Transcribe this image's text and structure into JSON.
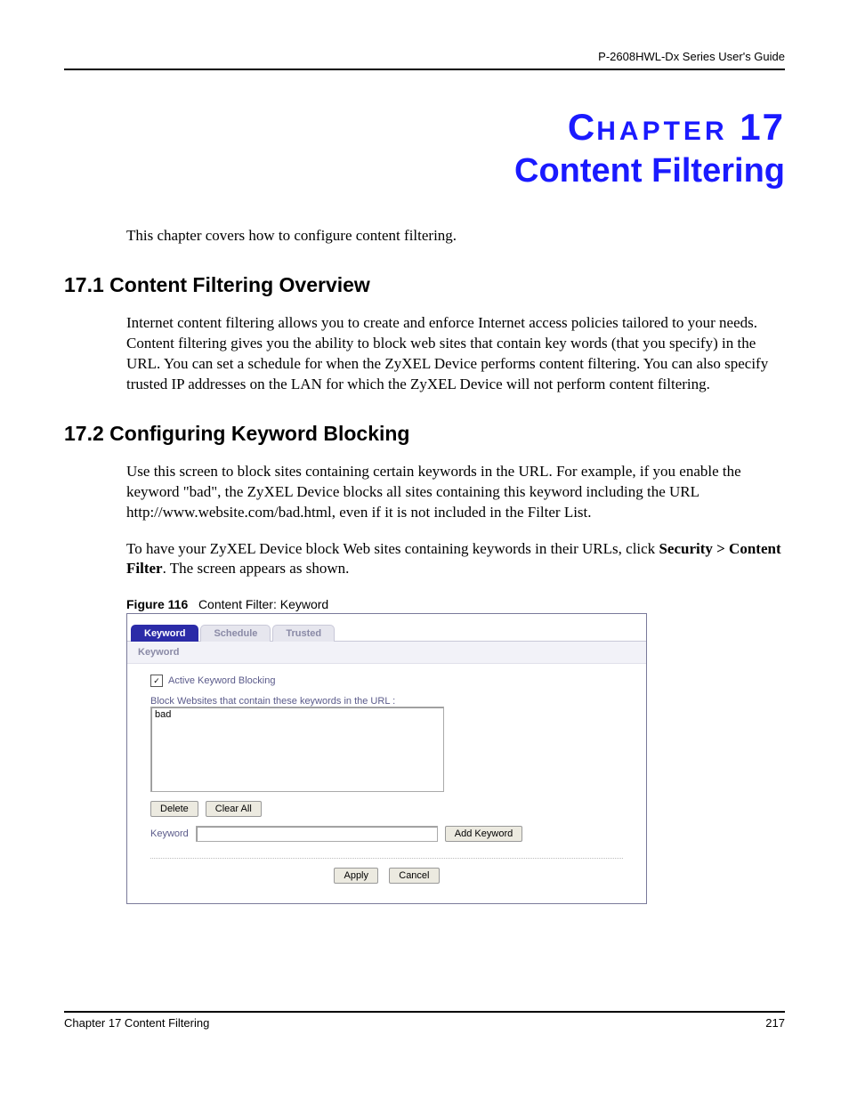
{
  "header": {
    "doc_title": "P-2608HWL-Dx Series User's Guide"
  },
  "chapter": {
    "label_small": "HAPTER",
    "label_prefix": "C",
    "number": "17",
    "title": "Content Filtering",
    "intro": "This chapter covers how to configure content filtering."
  },
  "section1": {
    "heading": "17.1  Content Filtering Overview",
    "body": "Internet content filtering allows you to create and enforce Internet access policies tailored to your needs. Content filtering gives you the ability to block web sites that contain key words (that you specify) in the URL. You can set a schedule for when the ZyXEL Device performs content filtering. You can also specify trusted IP addresses on the LAN for which the ZyXEL Device will not perform content filtering."
  },
  "section2": {
    "heading": "17.2  Configuring Keyword Blocking",
    "body": "Use this screen to block sites containing certain keywords in the URL. For example, if you enable the keyword \"bad\", the ZyXEL Device blocks all sites containing this keyword including the URL http://www.website.com/bad.html, even if it is not included in the Filter List.",
    "nav_pre": "To have your ZyXEL Device block Web sites containing keywords in their URLs, click ",
    "nav_bold": "Security > Content Filter",
    "nav_post": ". The screen appears as shown."
  },
  "figure": {
    "label": "Figure 116",
    "caption": "Content Filter: Keyword"
  },
  "ui": {
    "tabs": {
      "keyword": "Keyword",
      "schedule": "Schedule",
      "trusted": "Trusted"
    },
    "section_label": "Keyword",
    "checkbox_label": "Active Keyword Blocking",
    "checkbox_checked": "✓",
    "list_label": "Block Websites that contain these keywords in the URL :",
    "list_item": "bad",
    "btn_delete": "Delete",
    "btn_clear": "Clear All",
    "keyword_label": "Keyword",
    "btn_add": "Add Keyword",
    "btn_apply": "Apply",
    "btn_cancel": "Cancel"
  },
  "footer": {
    "left": "Chapter 17 Content Filtering",
    "right": "217"
  }
}
